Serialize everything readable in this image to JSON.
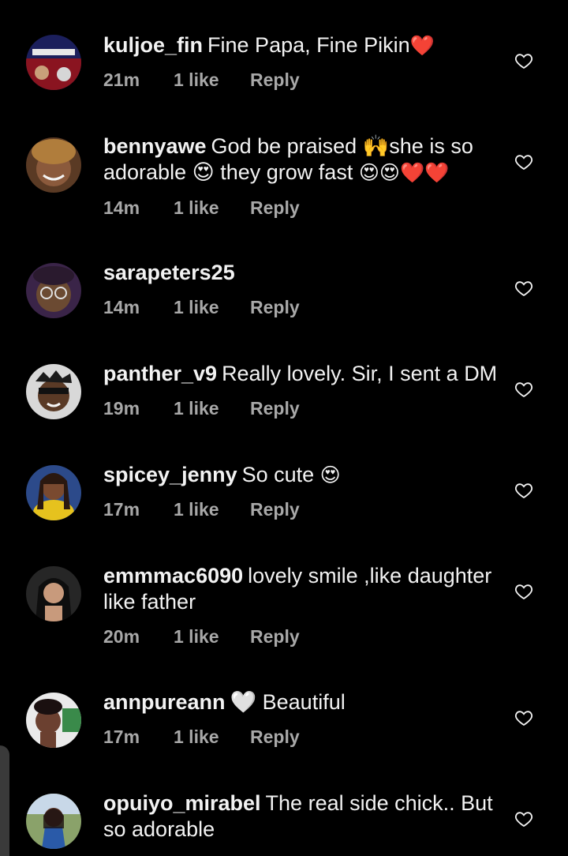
{
  "comments": [
    {
      "username": "kuljoe_fin",
      "text": "Fine Papa, Fine Pikin",
      "emoji": "❤️",
      "time": "21m",
      "likes": "1 like",
      "reply": "Reply"
    },
    {
      "username": "bennyawe",
      "text": "God be praised 🙌she is so adorable 😍 they grow fast",
      "emoji": "😍😍❤️❤️",
      "time": "14m",
      "likes": "1 like",
      "reply": "Reply"
    },
    {
      "username": "sarapeters25",
      "text": "",
      "emoji": "",
      "time": "14m",
      "likes": "1 like",
      "reply": "Reply"
    },
    {
      "username": "panther_v9",
      "text": "Really lovely. Sir, I sent a DM",
      "emoji": "",
      "time": "19m",
      "likes": "1 like",
      "reply": "Reply"
    },
    {
      "username": "spicey_jenny",
      "text": "So cute",
      "emoji": "😍",
      "time": "17m",
      "likes": "1 like",
      "reply": "Reply"
    },
    {
      "username": "emmmac6090",
      "text": "lovely smile ,like daughter like father",
      "emoji": "",
      "time": "20m",
      "likes": "1 like",
      "reply": "Reply"
    },
    {
      "username": "annpureann",
      "text": "🤍 Beautiful",
      "emoji": "",
      "time": "17m",
      "likes": "1 like",
      "reply": "Reply"
    },
    {
      "username": "opuiyo_mirabel",
      "text": "The real side chick.. But so adorable",
      "emoji": "",
      "time": "",
      "likes": "",
      "reply": ""
    }
  ],
  "icons": {
    "like": "heart-outline-icon"
  },
  "colors": {
    "background": "#000000",
    "text": "#f2f2f2",
    "meta": "#a8a8a8"
  }
}
